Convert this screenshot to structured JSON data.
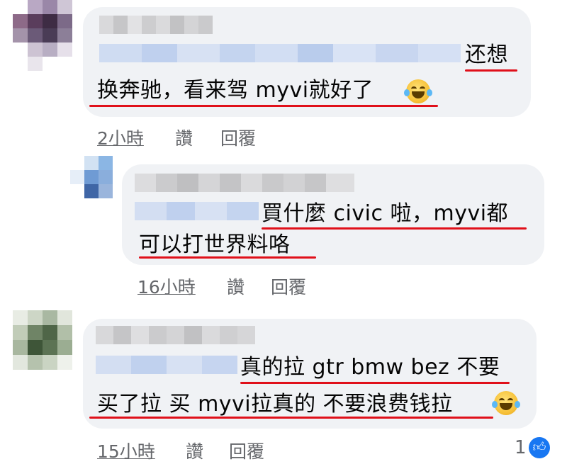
{
  "comments": [
    {
      "text_line1": "还想",
      "text_line2": "换奔驰，看来驾 myvi就好了",
      "time": "2小時",
      "like_label": "讚",
      "reply_label": "回覆"
    },
    {
      "text_line1": "買什麼 civic 啦，myvi都",
      "text_line2": "可以打世界料咯",
      "time": "16小時",
      "like_label": "讚",
      "reply_label": "回覆"
    },
    {
      "text_line1": "真的拉 gtr bmw bez 不要",
      "text_line2": "买了拉 买 myvi拉真的 不要浪费钱拉",
      "time": "15小時",
      "like_label": "讚",
      "reply_label": "回覆",
      "reaction_count": "1",
      "reaction_icon": "thumbs-up-icon"
    }
  ],
  "colors": {
    "bubble": "#f0f2f5",
    "underline": "#e0101a",
    "meta": "#65676b",
    "like_blue": "#1877f2"
  }
}
